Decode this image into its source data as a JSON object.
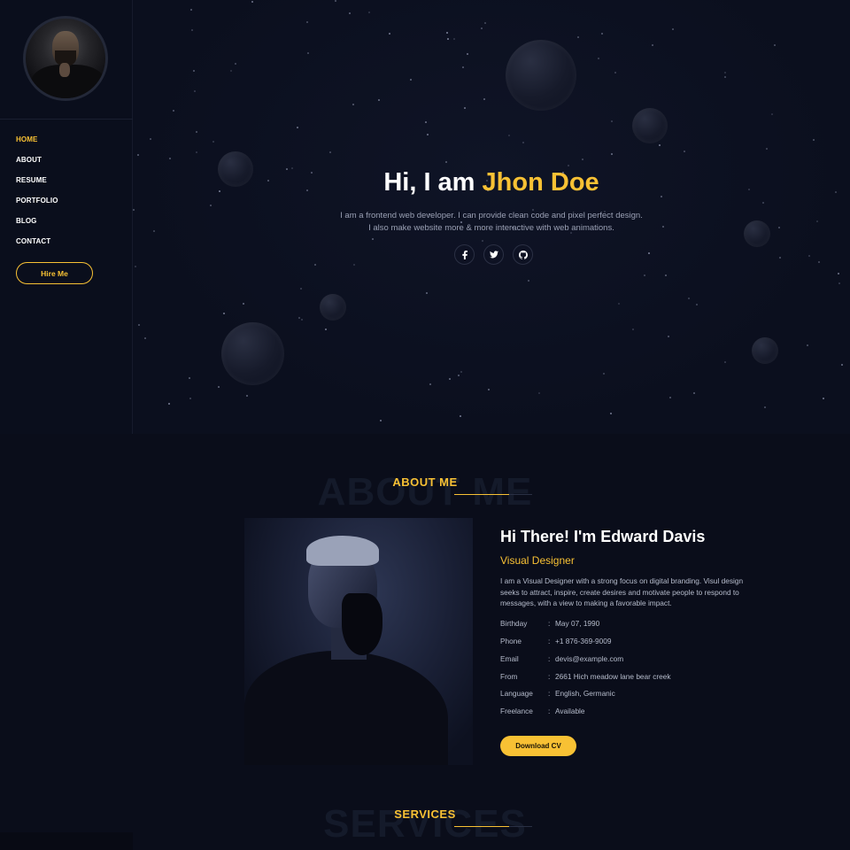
{
  "sidebar": {
    "nav": [
      {
        "label": "HOME",
        "active": true
      },
      {
        "label": "ABOUT",
        "active": false
      },
      {
        "label": "RESUME",
        "active": false
      },
      {
        "label": "PORTFOLIO",
        "active": false
      },
      {
        "label": "BLOG",
        "active": false
      },
      {
        "label": "CONTACT",
        "active": false
      }
    ],
    "hire_label": "Hire Me"
  },
  "hero": {
    "greeting": "Hi, I am",
    "name": "Jhon Doe",
    "desc_line1": "I am a frontend web developer. I can provide clean code and pixel perfect design.",
    "desc_line2": "I also make website more & more interactive with web animations.",
    "socials": [
      {
        "icon": "facebook-icon",
        "glyph": "f"
      },
      {
        "icon": "twitter-icon",
        "glyph": "t"
      },
      {
        "icon": "github-icon",
        "glyph": "gh"
      }
    ]
  },
  "about": {
    "ghost": "ABOUT ME",
    "title": "ABOUT ME",
    "name": "Hi There! I'm Edward Davis",
    "role": "Visual Designer",
    "text": "I am a Visual Designer with a strong focus on digital branding. Visul design seeks to attract, inspire, create desires and motivate people to respond to messages, with a view to making a favorable impact.",
    "info": [
      {
        "label": "Birthday",
        "value": "May 07, 1990"
      },
      {
        "label": "Phone",
        "value": "+1 876-369-9009"
      },
      {
        "label": "Email",
        "value": "devis@example.com"
      },
      {
        "label": "From",
        "value": "2661 Hich meadow lane bear creek"
      },
      {
        "label": "Language",
        "value": "English, Germanic"
      },
      {
        "label": "Freelance",
        "value": "Available"
      }
    ],
    "download_label": "Download CV"
  },
  "services": {
    "ghost": "SERVICES",
    "title": "SERVICES"
  },
  "colors": {
    "accent": "#f8c134",
    "background": "#0b0f1e"
  }
}
